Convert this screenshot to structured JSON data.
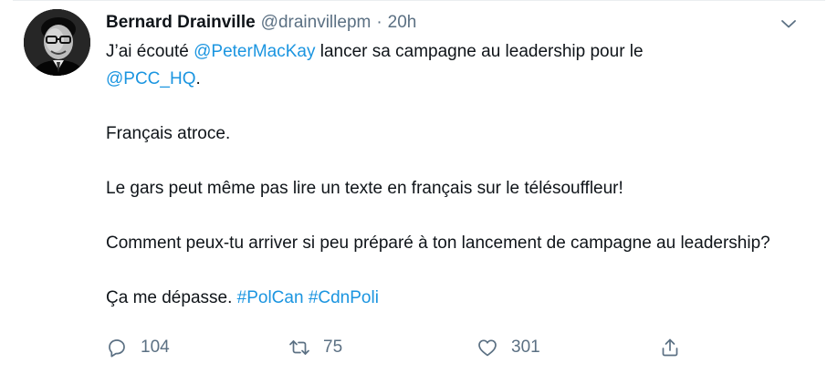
{
  "tweet": {
    "author_name": "Bernard Drainville",
    "author_handle": "@drainvillepm",
    "separator": "·",
    "timestamp": "20h",
    "paragraphs": [
      {
        "line1_text_a": "J’ai écouté ",
        "mention_1": "@PeterMacKay",
        "line1_text_b": " lancer sa campagne au leadership pour le",
        "mention_2": "@PCC_HQ",
        "line2_tail": "."
      },
      {
        "text": "Français atroce."
      },
      {
        "text": "Le gars peut même pas lire un texte en français sur le télésouffleur!"
      },
      {
        "text": "Comment peux-tu arriver si peu préparé à ton lancement de campagne au leadership?"
      },
      {
        "text": "Ça me dépasse. ",
        "hashtag_1": "#PolCan",
        "hashtag_2": "#CdnPoli"
      }
    ],
    "counts": {
      "replies": "104",
      "retweets": "75",
      "likes": "301"
    }
  },
  "icons": {
    "more": "chevron-down-icon",
    "reply": "reply-icon",
    "retweet": "retweet-icon",
    "like": "heart-icon",
    "share": "share-icon"
  },
  "colors": {
    "link": "#1b95e0",
    "muted": "#5b7083",
    "text": "#0f1419"
  }
}
